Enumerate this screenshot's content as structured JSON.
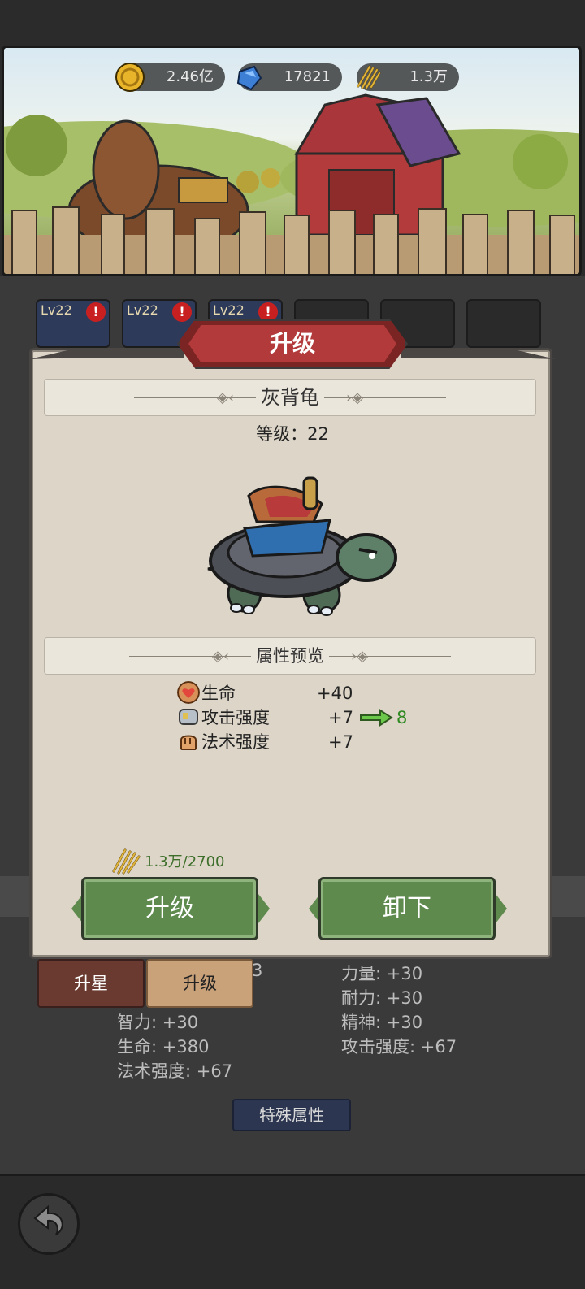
{
  "resources": {
    "gold": "2.46亿",
    "gems": "17821",
    "hay": "1.3万"
  },
  "tabs": [
    {
      "level": "Lv22",
      "alert": "!"
    },
    {
      "level": "Lv22",
      "alert": "!"
    },
    {
      "level": "Lv22",
      "alert": "!"
    }
  ],
  "dialog": {
    "title": "升级",
    "pet_name": "灰背龟",
    "level_label": "等级：22",
    "preview_header": "属性预览",
    "attributes": [
      {
        "name": "生命",
        "value": "+40",
        "next": ""
      },
      {
        "name": "攻击强度",
        "value": "+7",
        "next": "8"
      },
      {
        "name": "法术强度",
        "value": "+7",
        "next": ""
      }
    ],
    "cost": "1.3万/2700",
    "upgrade_button": "升级",
    "unequip_button": "卸下"
  },
  "background_panel": {
    "star_tab": "升星",
    "level_tab": "升级",
    "partial_digit": "3",
    "stats_left": [
      "智力: +30",
      "生命: +380",
      "法术强度: +67"
    ],
    "stats_right": [
      "力量: +30",
      "耐力: +30",
      "精神: +30",
      "攻击强度: +67"
    ],
    "special_button": "特殊属性"
  },
  "colors": {
    "accent_green": "#5e8a4e",
    "header_red": "#b33a3a",
    "dialog_bg": "#dcd5c8"
  }
}
